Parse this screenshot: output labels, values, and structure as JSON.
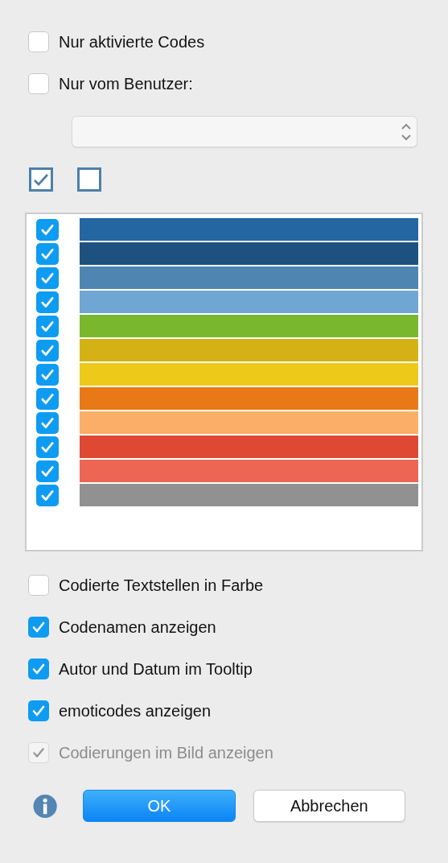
{
  "filters": [
    {
      "label": "Nur aktivierte Codes",
      "checked": false
    },
    {
      "label": "Nur vom Benutzer:",
      "checked": false
    }
  ],
  "select_buttons": [
    {
      "kind": "all"
    },
    {
      "kind": "none"
    }
  ],
  "codes": [
    {
      "checked": true,
      "color": "#2366a2"
    },
    {
      "checked": true,
      "color": "#1d5280"
    },
    {
      "checked": true,
      "color": "#4f86b1"
    },
    {
      "checked": true,
      "color": "#6fa6d3"
    },
    {
      "checked": true,
      "color": "#79b72e"
    },
    {
      "checked": true,
      "color": "#d4b216"
    },
    {
      "checked": true,
      "color": "#edca19"
    },
    {
      "checked": true,
      "color": "#e97916"
    },
    {
      "checked": true,
      "color": "#faae68"
    },
    {
      "checked": true,
      "color": "#df4833"
    },
    {
      "checked": true,
      "color": "#ec6653"
    },
    {
      "checked": true,
      "color": "#919191"
    }
  ],
  "options": [
    {
      "label": "Codierte Textstellen in Farbe",
      "checked": false,
      "disabled": false
    },
    {
      "label": "Codenamen anzeigen",
      "checked": true,
      "disabled": false
    },
    {
      "label": "Autor und Datum im Tooltip",
      "checked": true,
      "disabled": false
    },
    {
      "label": "emoticodes anzeigen",
      "checked": true,
      "disabled": false
    },
    {
      "label": "Codierungen im Bild anzeigen",
      "checked": true,
      "disabled": true
    }
  ],
  "buttons": [
    {
      "label": "OK",
      "kind": "default"
    },
    {
      "label": "Abbrechen",
      "kind": "normal"
    }
  ]
}
